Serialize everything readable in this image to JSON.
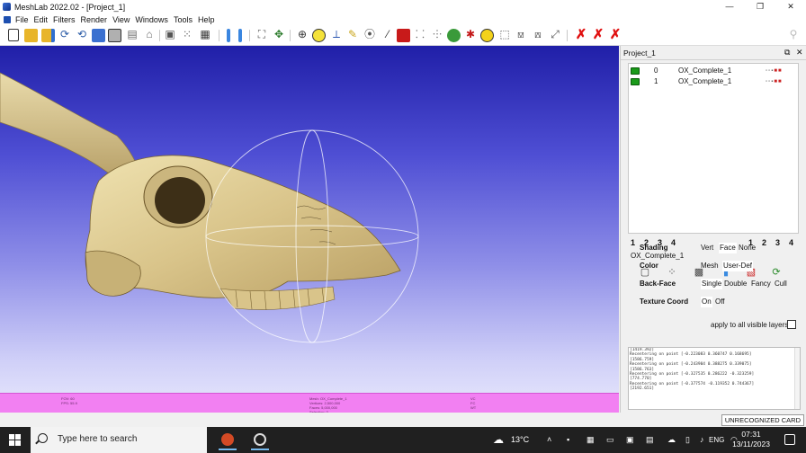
{
  "window": {
    "title": "MeshLab 2022.02 - [Project_1]",
    "buttons": [
      "—",
      "❐",
      "✕"
    ]
  },
  "menu": [
    "File",
    "Edit",
    "Filters",
    "Render",
    "View",
    "Windows",
    "Tools",
    "Help"
  ],
  "panel": {
    "title": "Project_1",
    "float_btn": "⧉",
    "close_btn": "✕",
    "layers": [
      {
        "id": "0",
        "name": "OX_Complete_1"
      },
      {
        "id": "1",
        "name": "OX_Complete_1"
      }
    ],
    "view_nums_left": [
      "1",
      "2",
      "3",
      "4"
    ],
    "view_nums_right": [
      "1",
      "2",
      "3",
      "4"
    ],
    "mesh_name": "OX_Complete_1",
    "shading": {
      "label": "Shading",
      "options": [
        "Vert",
        "Face",
        "None"
      ],
      "selected": "Face"
    },
    "color": {
      "label": "Color",
      "options": [
        "Mesh",
        "User-Def"
      ],
      "selected": "User-Def"
    },
    "backface": {
      "label": "Back-Face",
      "options": [
        "Single",
        "Double",
        "Fancy",
        "Cull"
      ],
      "selected": "Single"
    },
    "texcoord": {
      "label": "Texture Coord",
      "options": [
        "On",
        "Off"
      ],
      "selected": "On"
    },
    "apply_label": "apply to all visible layers",
    "log": [
      "[1419.392]",
      "Recentering on point [-0.223083 0.360747 0.168695]",
      "[1586.759]",
      "Recentering on point [-0.243904 0.388275 0.339075]",
      "[1586.763]",
      "Recentering on point [-0.327535 0.286222 -0.323259]",
      "[774.770]",
      "Recentering on point [-0.377574 -0.119352 0.744367]",
      "[2192.651]"
    ]
  },
  "infobar": {
    "left": "FOV: 60\nFPS: 55.9",
    "center": "Mesh: OX_Complete_1\nVertices: 2,500,000\nFaces: 5,000,000\nSelection: 0",
    "right": "VC\nFC\nWT"
  },
  "status": {
    "badge": "UNRECOGNIZED CARD"
  },
  "taskbar": {
    "search_placeholder": "Type here to search",
    "weather": "13°C",
    "language": "ENG",
    "time": "07:31",
    "date": "13/11/2023"
  }
}
